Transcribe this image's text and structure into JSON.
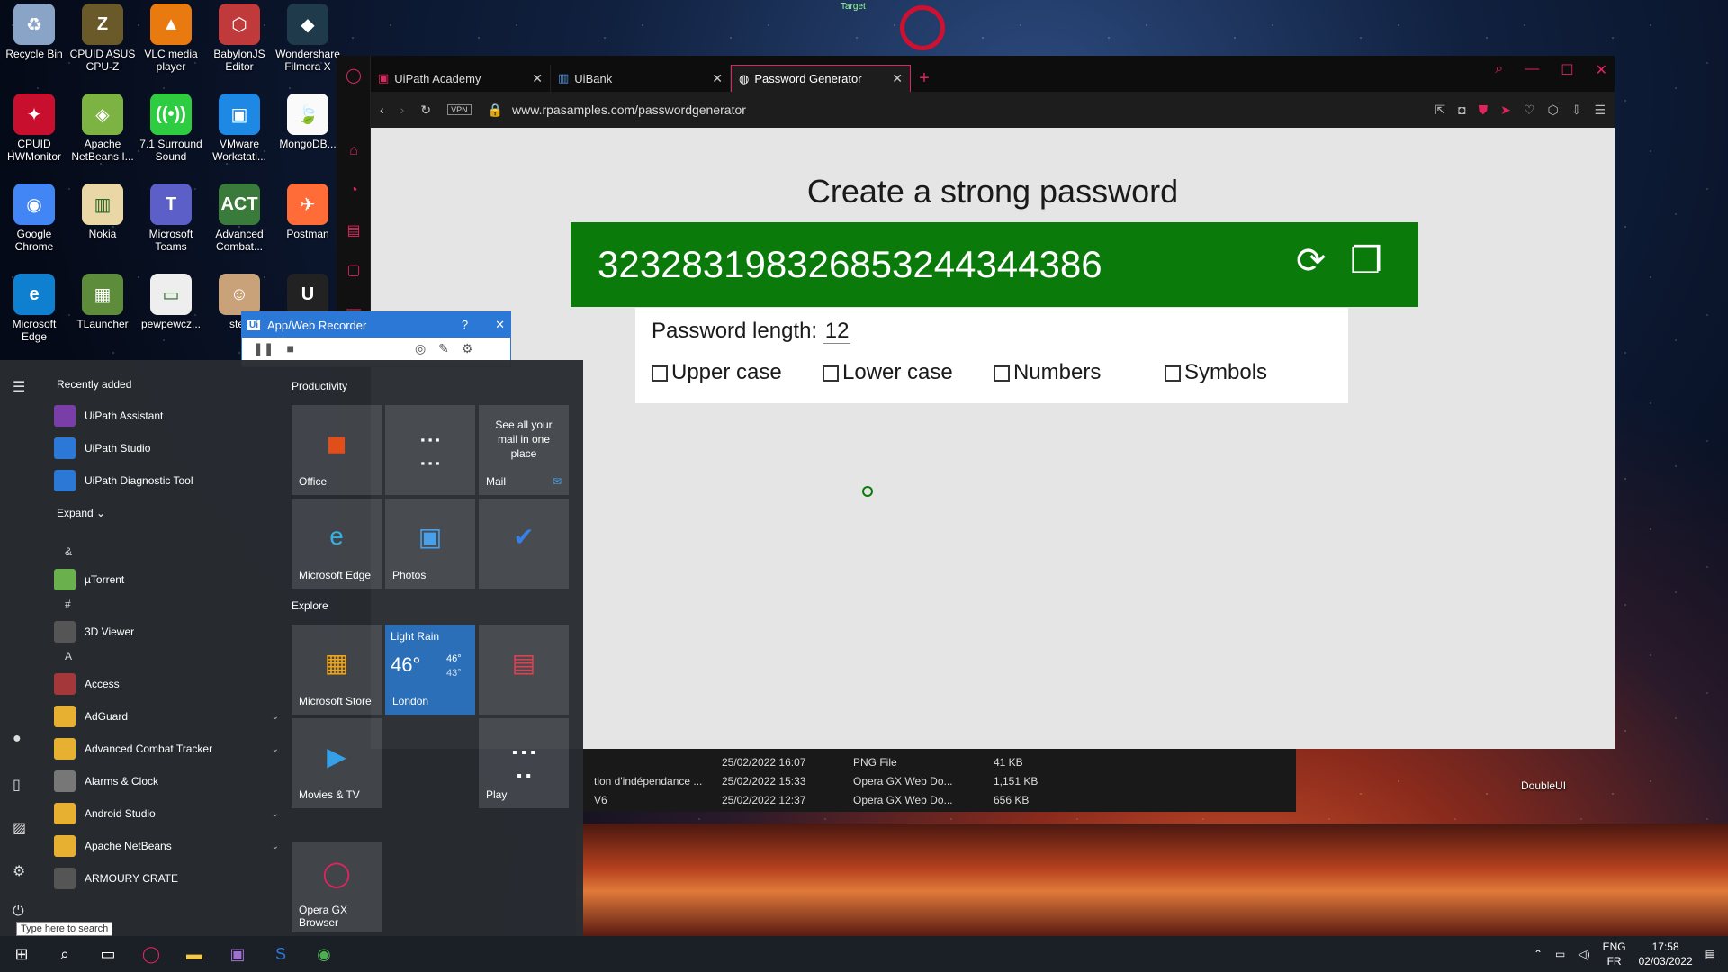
{
  "desktop_icons": [
    {
      "label": "Recycle Bin",
      "icon": "recycle-bin-icon",
      "color": "#8aa4c8",
      "glyph": "♻"
    },
    {
      "label": "CPUID ASUS CPU-Z",
      "icon": "cpuz-icon",
      "color": "#6a5a2a",
      "glyph": "Z"
    },
    {
      "label": "VLC media player",
      "icon": "vlc-icon",
      "color": "#e87a10",
      "glyph": "▲"
    },
    {
      "label": "BabylonJS Editor",
      "icon": "babylon-icon",
      "color": "#c0393b",
      "glyph": "⬡"
    },
    {
      "label": "Wondershare Filmora X",
      "icon": "filmora-icon",
      "color": "#1f3a4a",
      "glyph": "◆"
    },
    {
      "label": "CPUID HWMonitor",
      "icon": "hwmonitor-icon",
      "color": "#c8102e",
      "glyph": "✦"
    },
    {
      "label": "Apache NetBeans I...",
      "icon": "netbeans-icon",
      "color": "#7cb342",
      "glyph": "◈"
    },
    {
      "label": "7.1 Surround Sound",
      "icon": "surround-icon",
      "color": "#2ecc40",
      "glyph": "((•))"
    },
    {
      "label": "VMware Workstati...",
      "icon": "vmware-icon",
      "color": "#1e88e5",
      "glyph": "▣"
    },
    {
      "label": "MongoDB...",
      "icon": "mongodb-icon",
      "color": "#fafafa",
      "glyph": "🍃"
    },
    {
      "label": "Google Chrome",
      "icon": "chrome-icon",
      "color": "#4285f4",
      "glyph": "◉"
    },
    {
      "label": "Nokia",
      "icon": "nokia-icon",
      "color": "#e9d8a6",
      "glyph": "▥"
    },
    {
      "label": "Microsoft Teams",
      "icon": "teams-icon",
      "color": "#5b5fc7",
      "glyph": "T"
    },
    {
      "label": "Advanced Combat...",
      "icon": "act-icon",
      "color": "#3a7a3a",
      "glyph": "ACT"
    },
    {
      "label": "Postman",
      "icon": "postman-icon",
      "color": "#ff6c37",
      "glyph": "✈"
    },
    {
      "label": "Microsoft Edge",
      "icon": "edge-icon",
      "color": "#0f7fd0",
      "glyph": "e"
    },
    {
      "label": "TLauncher",
      "icon": "tlauncher-icon",
      "color": "#5d8c3a",
      "glyph": "▦"
    },
    {
      "label": "pewpewcz...",
      "icon": "image-file-icon",
      "color": "#eeeeee",
      "glyph": "▭"
    },
    {
      "label": "stev",
      "icon": "person-image-icon",
      "color": "#c9a27a",
      "glyph": "☺"
    },
    {
      "label": "",
      "icon": "unreal-icon",
      "color": "#222222",
      "glyph": "U"
    }
  ],
  "top_desktop_labels": [
    "Target"
  ],
  "right_desktop_label": "DoubleUI",
  "browser": {
    "tabs": [
      {
        "label": "UiPath Academy",
        "icon": "uipath-tab-icon"
      },
      {
        "label": "UiBank",
        "icon": "uibank-tab-icon"
      },
      {
        "label": "Password Generator",
        "icon": "globe-tab-icon"
      }
    ],
    "vpn": "VPN",
    "url": "www.rpasamples.com/passwordgenerator",
    "accent": "#e0245e"
  },
  "page": {
    "title": "Create a strong password",
    "password": "323283198326853244344386",
    "length_label": "Password length:",
    "length_value": "12",
    "options": [
      "Upper case",
      "Lower case",
      "Numbers",
      "Symbols"
    ],
    "box_color": "#0a7a0a"
  },
  "recorder": {
    "title": "App/Web Recorder",
    "help": "?",
    "close": "✕"
  },
  "files": [
    {
      "name": "",
      "date": "25/02/2022 16:07",
      "type": "PNG File",
      "size": "41 KB"
    },
    {
      "name": "tion d'indépendance ...",
      "date": "25/02/2022 15:33",
      "type": "Opera GX Web Do...",
      "size": "1,151 KB"
    },
    {
      "name": "V6",
      "date": "25/02/2022 12:37",
      "type": "Opera GX Web Do...",
      "size": "656 KB"
    }
  ],
  "start": {
    "recently_added": "Recently added",
    "recent_apps": [
      "UiPath Assistant",
      "UiPath Studio",
      "UiPath Diagnostic Tool"
    ],
    "expand": "Expand",
    "groups": [
      {
        "letter": "&",
        "apps": [
          "µTorrent"
        ]
      },
      {
        "letter": "#",
        "apps": [
          "3D Viewer"
        ]
      },
      {
        "letter": "A",
        "apps": [
          "Access",
          "AdGuard",
          "Advanced Combat Tracker",
          "Alarms & Clock",
          "Android Studio",
          "Apache NetBeans",
          "ARMOURY CRATE"
        ]
      }
    ],
    "productivity": "Productivity",
    "explore": "Explore",
    "tiles": {
      "office": "Office",
      "mail_text": "See all your mail in one place",
      "mail": "Mail",
      "edge": "Microsoft Edge",
      "photos": "Photos",
      "store": "Microsoft Store",
      "weather_cond": "Light Rain",
      "weather_temp": "46°",
      "weather_hi": "46°",
      "weather_lo": "43°",
      "weather_city": "London",
      "movies": "Movies & TV",
      "play": "Play",
      "opera": "Opera GX Browser"
    },
    "search_tip": "Type here to search"
  },
  "taskbar": {
    "lang1": "ENG",
    "lang2": "FR",
    "time": "17:58",
    "date": "02/03/2022"
  }
}
